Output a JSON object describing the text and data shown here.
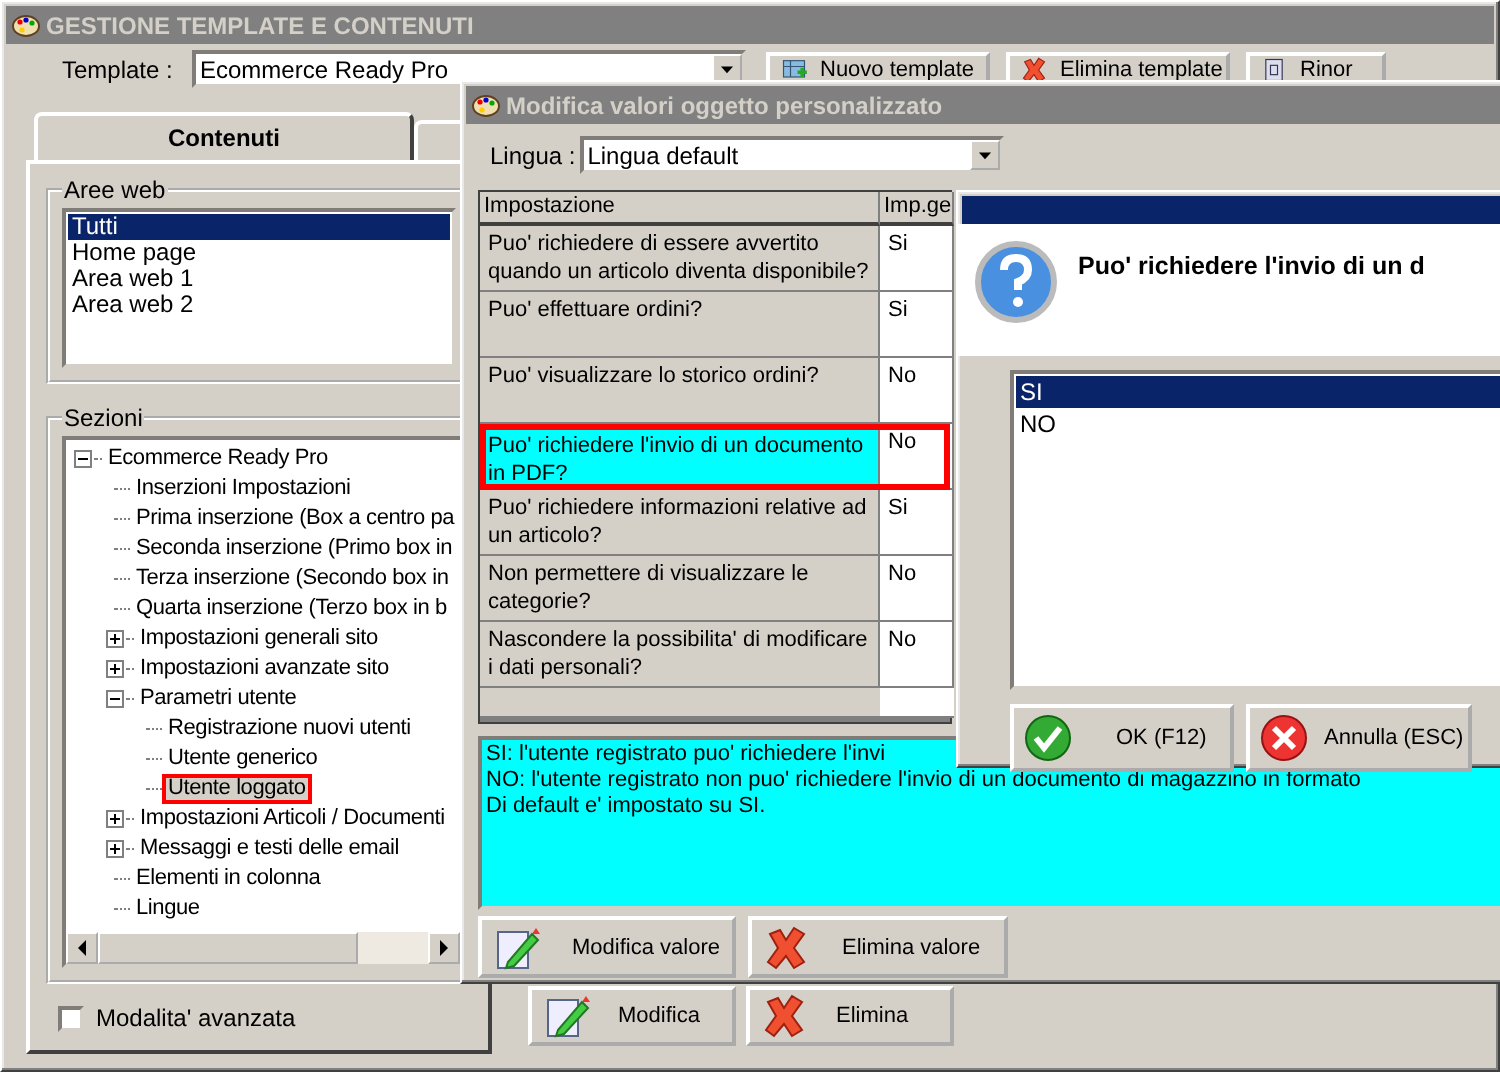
{
  "main_window": {
    "title": "GESTIONE TEMPLATE E CONTENUTI",
    "template": {
      "label": "Template :",
      "value": "Ecommerce Ready Pro"
    },
    "toolbar": [
      {
        "label": "Nuovo template",
        "kind": "new"
      },
      {
        "label": "Elimina template",
        "kind": "delete"
      },
      {
        "label": "Rinor",
        "kind": "document"
      }
    ],
    "tab": {
      "label": "Contenuti"
    },
    "web_areas": {
      "title": "Aree web",
      "items": [
        {
          "label": "Tutti",
          "selected": true
        },
        {
          "label": "Home page",
          "selected": false
        },
        {
          "label": "Area web 1",
          "selected": false
        },
        {
          "label": "Area web 2",
          "selected": false
        }
      ]
    },
    "sections": {
      "title": "Sezioni",
      "tree": [
        {
          "label": "Ecommerce Ready Pro",
          "expanded": true,
          "selected": false,
          "children": [
            {
              "label": "Inserzioni Impostazioni",
              "selected": false
            },
            {
              "label": "Prima inserzione (Box a centro pa",
              "selected": false
            },
            {
              "label": "Seconda inserzione (Primo box in",
              "selected": false
            },
            {
              "label": "Terza inserzione (Secondo box in",
              "selected": false
            },
            {
              "label": "Quarta inserzione (Terzo box in b",
              "selected": false
            },
            {
              "label": "Impostazioni generali sito",
              "expanded": false,
              "selected": false
            },
            {
              "label": "Impostazioni avanzate sito",
              "expanded": false,
              "selected": false
            },
            {
              "label": "Parametri utente",
              "expanded": true,
              "selected": false,
              "children": [
                {
                  "label": "Registrazione nuovi utenti",
                  "selected": false
                },
                {
                  "label": "Utente generico",
                  "selected": false
                },
                {
                  "label": "Utente loggato",
                  "selected": true,
                  "highlighted": true
                }
              ]
            },
            {
              "label": "Impostazioni Articoli / Documenti",
              "expanded": false,
              "selected": false
            },
            {
              "label": "Messaggi e testi delle email",
              "expanded": false,
              "selected": false
            },
            {
              "label": "Elementi in colonna",
              "selected": false
            },
            {
              "label": "Lingue",
              "selected": false
            }
          ]
        }
      ]
    },
    "advanced_mode": {
      "label": "Modalita' avanzata",
      "checked": false
    },
    "buttons": [
      {
        "label": "Modifica",
        "kind": "edit"
      },
      {
        "label": "Elimina",
        "kind": "delete"
      }
    ]
  },
  "edit_dialog": {
    "title": "Modifica valori oggetto personalizzato",
    "language": {
      "label": "Lingua :",
      "value": "Lingua default"
    },
    "table": {
      "columns": [
        "Impostazione",
        "Imp.ge"
      ],
      "rows": [
        {
          "setting": "Puo' richiedere di essere avvertito quando un articolo diventa disponibile?",
          "value": "Si",
          "selected": false
        },
        {
          "setting": "Puo' effettuare ordini?",
          "value": "Si",
          "selected": false
        },
        {
          "setting": "Puo' visualizzare lo storico ordini?",
          "value": "No",
          "selected": false
        },
        {
          "setting": "Puo' richiedere l'invio di un documento in PDF?",
          "value": "No",
          "selected": true,
          "highlighted": true
        },
        {
          "setting": "Puo' richiedere informazioni relative ad un articolo?",
          "value": "Si",
          "selected": false
        },
        {
          "setting": "Non permettere di visualizzare le categorie?",
          "value": "No",
          "selected": false
        },
        {
          "setting": "Nascondere la possibilita' di modificare i dati personali?",
          "value": "No",
          "selected": false
        }
      ]
    },
    "description": [
      "SI: l'utente registrato puo' richiedere l'invi",
      "NO: l'utente registrato non puo' richiedere l'invio di un documento di magazzino in formato",
      "Di default e' impostato su SI."
    ],
    "buttons": [
      {
        "label": "Modifica valore",
        "kind": "edit"
      },
      {
        "label": "Elimina valore",
        "kind": "delete"
      }
    ]
  },
  "choice_dialog": {
    "question": "Puo' richiedere l'invio di un d",
    "options": [
      {
        "label": "SI",
        "selected": true
      },
      {
        "label": "NO",
        "selected": false
      }
    ],
    "buttons": [
      {
        "label": "OK (F12)",
        "kind": "ok"
      },
      {
        "label": "Annulla (ESC)",
        "kind": "cancel"
      }
    ]
  }
}
